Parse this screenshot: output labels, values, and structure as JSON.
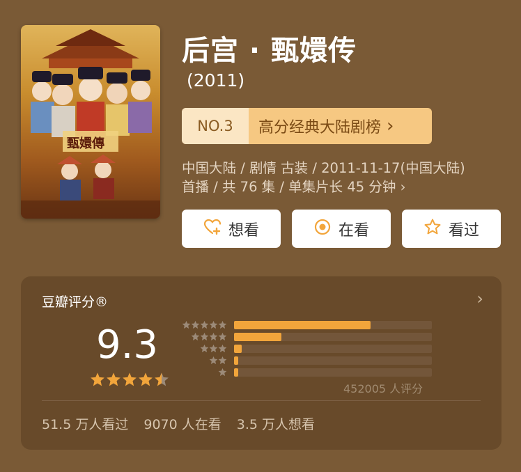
{
  "movie": {
    "title": "后宫 · 甄嬛传",
    "year": "(2011)",
    "poster_title": "甄嬛傳",
    "rank": {
      "number": "NO.3",
      "label": "高分经典大陆剧榜",
      "chevron": "›"
    },
    "meta_line1": "中国大陆 / 剧情 古装 / 2011-11-17(中国大陆)",
    "meta_line2": "首播 / 共 76 集 / 单集片长 45 分钟",
    "meta_chevron": "›"
  },
  "actions": [
    {
      "label": "想看",
      "icon": "heart-plus-icon"
    },
    {
      "label": "在看",
      "icon": "target-circle-icon"
    },
    {
      "label": "看过",
      "icon": "star-outline-icon"
    }
  ],
  "rating": {
    "heading": "豆瓣评分®",
    "chevron": "›",
    "score": "9.3",
    "stars_average": 4.5,
    "distribution_fractions": [
      0.69,
      0.24,
      0.04,
      0.02,
      0.02
    ],
    "count_text": "452005 人评分"
  },
  "stats": {
    "watched": "51.5 万人看过",
    "watching": "9070 人在看",
    "wish": "3.5 万人想看"
  },
  "colors": {
    "background": "#7a5a36",
    "card": "#684a2a",
    "accent": "#f2a53b",
    "rank_bg": "#f6c882"
  }
}
